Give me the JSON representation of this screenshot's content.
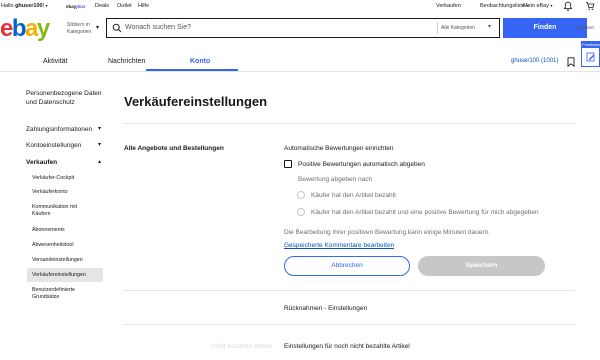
{
  "topbar": {
    "greeting_prefix": "Hallo ",
    "username": "ghuser100",
    "greeting_suffix": "!",
    "ebayplus_prefix": "ebay",
    "ebayplus_suffix": "plus",
    "deals": "Deals",
    "outlet": "Outlet",
    "help": "Hilfe",
    "sell": "Verkaufen",
    "watchlist": "Beobachtungsliste",
    "my_ebay": "Mein eBay",
    "caret": "▾"
  },
  "header": {
    "logo": [
      "e",
      "b",
      "a",
      "y"
    ],
    "browse_categories": "Stöbern in Kategorien",
    "search_placeholder": "Wonach suchen Sie?",
    "category_select": "Alle Kategorien",
    "find_button": "Finden",
    "advanced": "Erweitert"
  },
  "feedback": {
    "label": "Feedback"
  },
  "tabs": [
    {
      "label": "Aktivität"
    },
    {
      "label": "Nachrichten"
    },
    {
      "label": "Konto"
    }
  ],
  "account_link": "ghuser100  (1001)",
  "sidebar": {
    "items": [
      {
        "label": "Personenbezogene Daten und Datenschutz"
      },
      {
        "label": "Zahlungsinformationen"
      },
      {
        "label": "Kontoeinstellungen"
      },
      {
        "label": "Verkaufen"
      }
    ],
    "sub_items": [
      {
        "label": "Verkäufer-Cockpit"
      },
      {
        "label": "Verkäuferkonto"
      },
      {
        "label": "Kommunikation mit Käufern"
      },
      {
        "label": "Abonnements"
      },
      {
        "label": "Abwesenheitstool"
      },
      {
        "label": "Versandeinstellungen"
      },
      {
        "label": "Verkäufereinstellungen"
      },
      {
        "label": "Benutzerdefinierte Grundsätze"
      }
    ]
  },
  "main": {
    "title": "Verkäufereinstellungen",
    "section_label": "Alle Angebote und Bestellungen",
    "auto_feedback_title": "Automatische Bewertungen einrichten",
    "checkbox_label": "Positive Bewertungen automatisch abgeben",
    "feedback_after": "Bewertung abgeben nach",
    "radio_1": "Käufer hat den Artikel bezahlt",
    "radio_2": "Käufer hat den Artikel bezahlt und eine positive Bewertung für mich abgegeben",
    "processing_note": "Die Bearbeitung Ihrer positiven Bewertung kann einige Minuten dauern.",
    "edit_comments_link": "Gespeicherte Kommentare bearbeiten",
    "cancel_button": "Abbrechen",
    "save_button": "Speichern",
    "returns_title": "Rücknahmen - Einstellungen",
    "unpaid_title": "Einstellungen für noch nicht bezahlte Artikel",
    "ghost_label": "nicht bezahlte Artikel"
  }
}
